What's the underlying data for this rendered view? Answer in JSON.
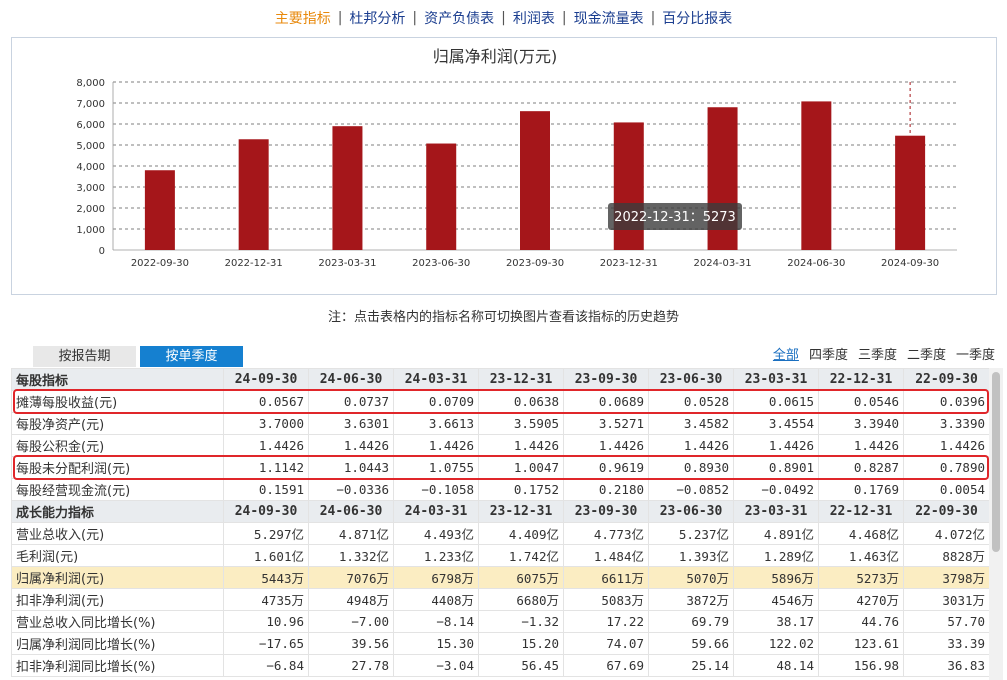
{
  "nav": {
    "items": [
      {
        "label": "主要指标",
        "active": true
      },
      {
        "label": "杜邦分析",
        "active": false
      },
      {
        "label": "资产负债表",
        "active": false
      },
      {
        "label": "利润表",
        "active": false
      },
      {
        "label": "现金流量表",
        "active": false
      },
      {
        "label": "百分比报表",
        "active": false
      }
    ],
    "separator": "|"
  },
  "chart_data": {
    "type": "bar",
    "title": "归属净利润(万元)",
    "categories": [
      "2022-09-30",
      "2022-12-31",
      "2023-03-31",
      "2023-06-30",
      "2023-09-30",
      "2023-12-31",
      "2024-03-31",
      "2024-06-30",
      "2024-09-30"
    ],
    "values": [
      3798,
      5273,
      5896,
      5070,
      6611,
      6075,
      6798,
      7076,
      5443
    ],
    "ylim": [
      0,
      8000
    ],
    "yticks": [
      "0",
      "1,000",
      "2,000",
      "3,000",
      "4,000",
      "5,000",
      "6,000",
      "7,000",
      "8,000"
    ],
    "ytick_values": [
      0,
      1000,
      2000,
      3000,
      4000,
      5000,
      6000,
      7000,
      8000
    ],
    "grid": true,
    "bar_color": "#a5161a",
    "hover_index": 8,
    "tooltip": {
      "text": "2022-12-31：5273"
    }
  },
  "note": "注：点击表格内的指标名称可切换图片查看该指标的历史趋势",
  "tabs": [
    {
      "label": "按报告期",
      "active": false
    },
    {
      "label": "按单季度",
      "active": true
    }
  ],
  "period_filter": [
    {
      "label": "全部",
      "active": true
    },
    {
      "label": "四季度",
      "active": false
    },
    {
      "label": "三季度",
      "active": false
    },
    {
      "label": "二季度",
      "active": false
    },
    {
      "label": "一季度",
      "active": false
    }
  ],
  "table": {
    "sections": [
      {
        "title": "每股指标",
        "headers": [
          "24-09-30",
          "24-06-30",
          "24-03-31",
          "23-12-31",
          "23-09-30",
          "23-06-30",
          "23-03-31",
          "22-12-31",
          "22-09-30"
        ],
        "rows": [
          {
            "name": "摊薄每股收益(元)",
            "values": [
              "0.0567",
              "0.0737",
              "0.0709",
              "0.0638",
              "0.0689",
              "0.0528",
              "0.0615",
              "0.0546",
              "0.0396"
            ],
            "boxed": true
          },
          {
            "name": "每股净资产(元)",
            "values": [
              "3.7000",
              "3.6301",
              "3.6613",
              "3.5905",
              "3.5271",
              "3.4582",
              "3.4554",
              "3.3940",
              "3.3390"
            ]
          },
          {
            "name": "每股公积金(元)",
            "values": [
              "1.4426",
              "1.4426",
              "1.4426",
              "1.4426",
              "1.4426",
              "1.4426",
              "1.4426",
              "1.4426",
              "1.4426"
            ]
          },
          {
            "name": "每股未分配利润(元)",
            "values": [
              "1.1142",
              "1.0443",
              "1.0755",
              "1.0047",
              "0.9619",
              "0.8930",
              "0.8901",
              "0.8287",
              "0.7890"
            ],
            "boxed": true
          },
          {
            "name": "每股经营现金流(元)",
            "values": [
              "0.1591",
              "−0.0336",
              "−0.1058",
              "0.1752",
              "0.2180",
              "−0.0852",
              "−0.0492",
              "0.1769",
              "0.0054"
            ]
          }
        ]
      },
      {
        "title": "成长能力指标",
        "headers": [
          "24-09-30",
          "24-06-30",
          "24-03-31",
          "23-12-31",
          "23-09-30",
          "23-06-30",
          "23-03-31",
          "22-12-31",
          "22-09-30"
        ],
        "rows": [
          {
            "name": "营业总收入(元)",
            "values": [
              "5.297亿",
              "4.871亿",
              "4.493亿",
              "4.409亿",
              "4.773亿",
              "5.237亿",
              "4.891亿",
              "4.468亿",
              "4.072亿"
            ]
          },
          {
            "name": "毛利润(元)",
            "values": [
              "1.601亿",
              "1.332亿",
              "1.233亿",
              "1.742亿",
              "1.484亿",
              "1.393亿",
              "1.289亿",
              "1.463亿",
              "8828万"
            ]
          },
          {
            "name": "归属净利润(元)",
            "values": [
              "5443万",
              "7076万",
              "6798万",
              "6075万",
              "6611万",
              "5070万",
              "5896万",
              "5273万",
              "3798万"
            ],
            "highlight": true
          },
          {
            "name": "扣非净利润(元)",
            "values": [
              "4735万",
              "4948万",
              "4408万",
              "6680万",
              "5083万",
              "3872万",
              "4546万",
              "4270万",
              "3031万"
            ]
          },
          {
            "name": "营业总收入同比增长(%)",
            "values": [
              "10.96",
              "−7.00",
              "−8.14",
              "−1.32",
              "17.22",
              "69.79",
              "38.17",
              "44.76",
              "57.70"
            ]
          },
          {
            "name": "归属净利润同比增长(%)",
            "values": [
              "−17.65",
              "39.56",
              "15.30",
              "15.20",
              "74.07",
              "59.66",
              "122.02",
              "123.61",
              "33.39"
            ]
          },
          {
            "name": "扣非净利润同比增长(%)",
            "values": [
              "−6.84",
              "27.78",
              "−3.04",
              "56.45",
              "67.69",
              "25.14",
              "48.14",
              "156.98",
              "36.83"
            ]
          }
        ]
      }
    ]
  }
}
